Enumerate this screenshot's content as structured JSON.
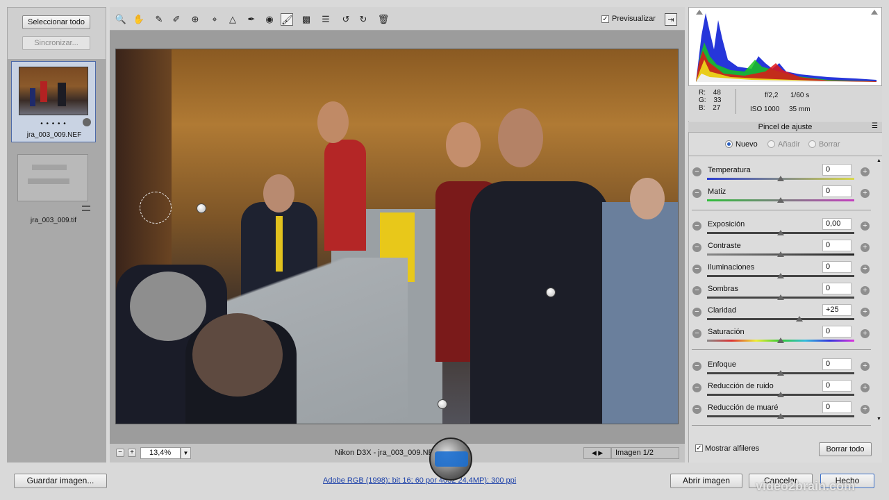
{
  "filmstrip": {
    "select_all": "Seleccionar todo",
    "sync": "Sincronizar...",
    "items": [
      {
        "name": "jra_003_009.NEF",
        "dots": "• • • • •"
      },
      {
        "name": "jra_003_009.tif"
      }
    ]
  },
  "toolbar": {
    "tools": [
      "zoom-tool",
      "hand-tool",
      "white-balance-tool",
      "color-sampler-tool",
      "targeted-adjustment-tool",
      "crop-tool",
      "straighten-tool",
      "spot-removal-tool",
      "red-eye-tool",
      "adjustment-brush-tool",
      "graduated-filter-tool",
      "preferences-tool",
      "rotate-left-tool",
      "rotate-right-tool",
      "trash-tool"
    ],
    "preview_label": "Previsualizar",
    "preview_checked": true
  },
  "status": {
    "zoom": "13,4%",
    "filename": "Nikon D3X -  jra_003_009.NEF",
    "image_count": "Imagen 1/2"
  },
  "info": {
    "r_label": "R:",
    "r": "48",
    "g_label": "G:",
    "g": "33",
    "b_label": "B:",
    "b": "27",
    "aperture": "f/2,2",
    "shutter": "1/60 s",
    "iso": "ISO 1000",
    "focal": "35 mm"
  },
  "panel": {
    "title": "Pincel de ajuste",
    "modes": [
      "Nuevo",
      "Añadir",
      "Borrar"
    ],
    "sliders": [
      {
        "label": "Temperatura",
        "value": "0",
        "pos": 0.5
      },
      {
        "label": "Matiz",
        "value": "0",
        "pos": 0.5
      },
      {
        "label": "Exposición",
        "value": "0,00",
        "pos": 0.5
      },
      {
        "label": "Contraste",
        "value": "0",
        "pos": 0.5
      },
      {
        "label": "Iluminaciones",
        "value": "0",
        "pos": 0.5
      },
      {
        "label": "Sombras",
        "value": "0",
        "pos": 0.5
      },
      {
        "label": "Claridad",
        "value": "+25",
        "pos": 0.625
      },
      {
        "label": "Saturación",
        "value": "0",
        "pos": 0.5
      },
      {
        "label": "Enfoque",
        "value": "0",
        "pos": 0.5
      },
      {
        "label": "Reducción de ruido",
        "value": "0",
        "pos": 0.5
      },
      {
        "label": "Reducción de muaré",
        "value": "0",
        "pos": 0.5
      }
    ],
    "show_pins": "Mostrar alfileres",
    "clear_all": "Borrar todo"
  },
  "footer": {
    "save": "Guardar imagen...",
    "workflow_link": "Adobe RGB (1998); bit 16; 60  por 4032  24,4MP); 300 ppi",
    "open": "Abrir imagen",
    "cancel": "Cancelar",
    "done": "Hecho",
    "watermark": "video2brain.com"
  }
}
